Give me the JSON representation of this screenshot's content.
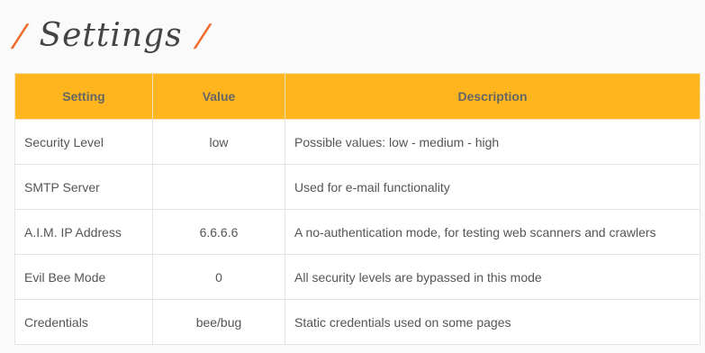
{
  "title": {
    "prefix": "/",
    "text": "Settings",
    "suffix": "/"
  },
  "table": {
    "headers": [
      "Setting",
      "Value",
      "Description"
    ],
    "rows": [
      {
        "setting": "Security Level",
        "value": "low",
        "description": "Possible values: low - medium - high"
      },
      {
        "setting": "SMTP Server",
        "value": "",
        "description": "Used for e-mail functionality"
      },
      {
        "setting": "A.I.M. IP Address",
        "value": "6.6.6.6",
        "description": "A no-authentication mode, for testing web scanners and crawlers"
      },
      {
        "setting": "Evil Bee Mode",
        "value": "0",
        "description": "All security levels are bypassed in this mode"
      },
      {
        "setting": "Credentials",
        "value": "bee/bug",
        "description": "Static credentials used on some pages"
      }
    ]
  },
  "colors": {
    "accent": "#ffb61e",
    "title_slash": "#f26a2b"
  }
}
